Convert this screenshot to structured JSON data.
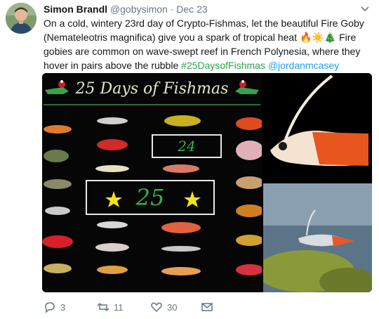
{
  "tweet": {
    "name": "Simon Brandl",
    "handle": "@gobysimon",
    "separator": "·",
    "date": "Dec 23",
    "text_part1": "On a cold, wintery 23rd day of Crypto-Fishmas, let the beautiful Fire Goby (Nemateleotris magnifica) give you a spark of tropical heat 🔥☀️🎄 Fire gobies are common on wave-swept reef in French Polynesia, where they hover in pairs above the rubble ",
    "hashtag": "#25DaysofFishmas",
    "space": " ",
    "mention": "@jordanmcasey"
  },
  "media": {
    "poster_title": "25 Days of Fishmas",
    "box_24": "24",
    "box_25": "25"
  },
  "actions": {
    "reply_count": "3",
    "retweet_count": "11",
    "like_count": "30"
  },
  "icons": {
    "reply": "reply-icon",
    "retweet": "retweet-icon",
    "like": "heart-icon",
    "dm": "envelope-icon",
    "menu": "chevron-down-icon"
  },
  "colors": {
    "hashtag": "#2aa34a",
    "mention": "#1da1f2",
    "secondary_text": "#657786",
    "poster_green": "#2fb24a"
  }
}
